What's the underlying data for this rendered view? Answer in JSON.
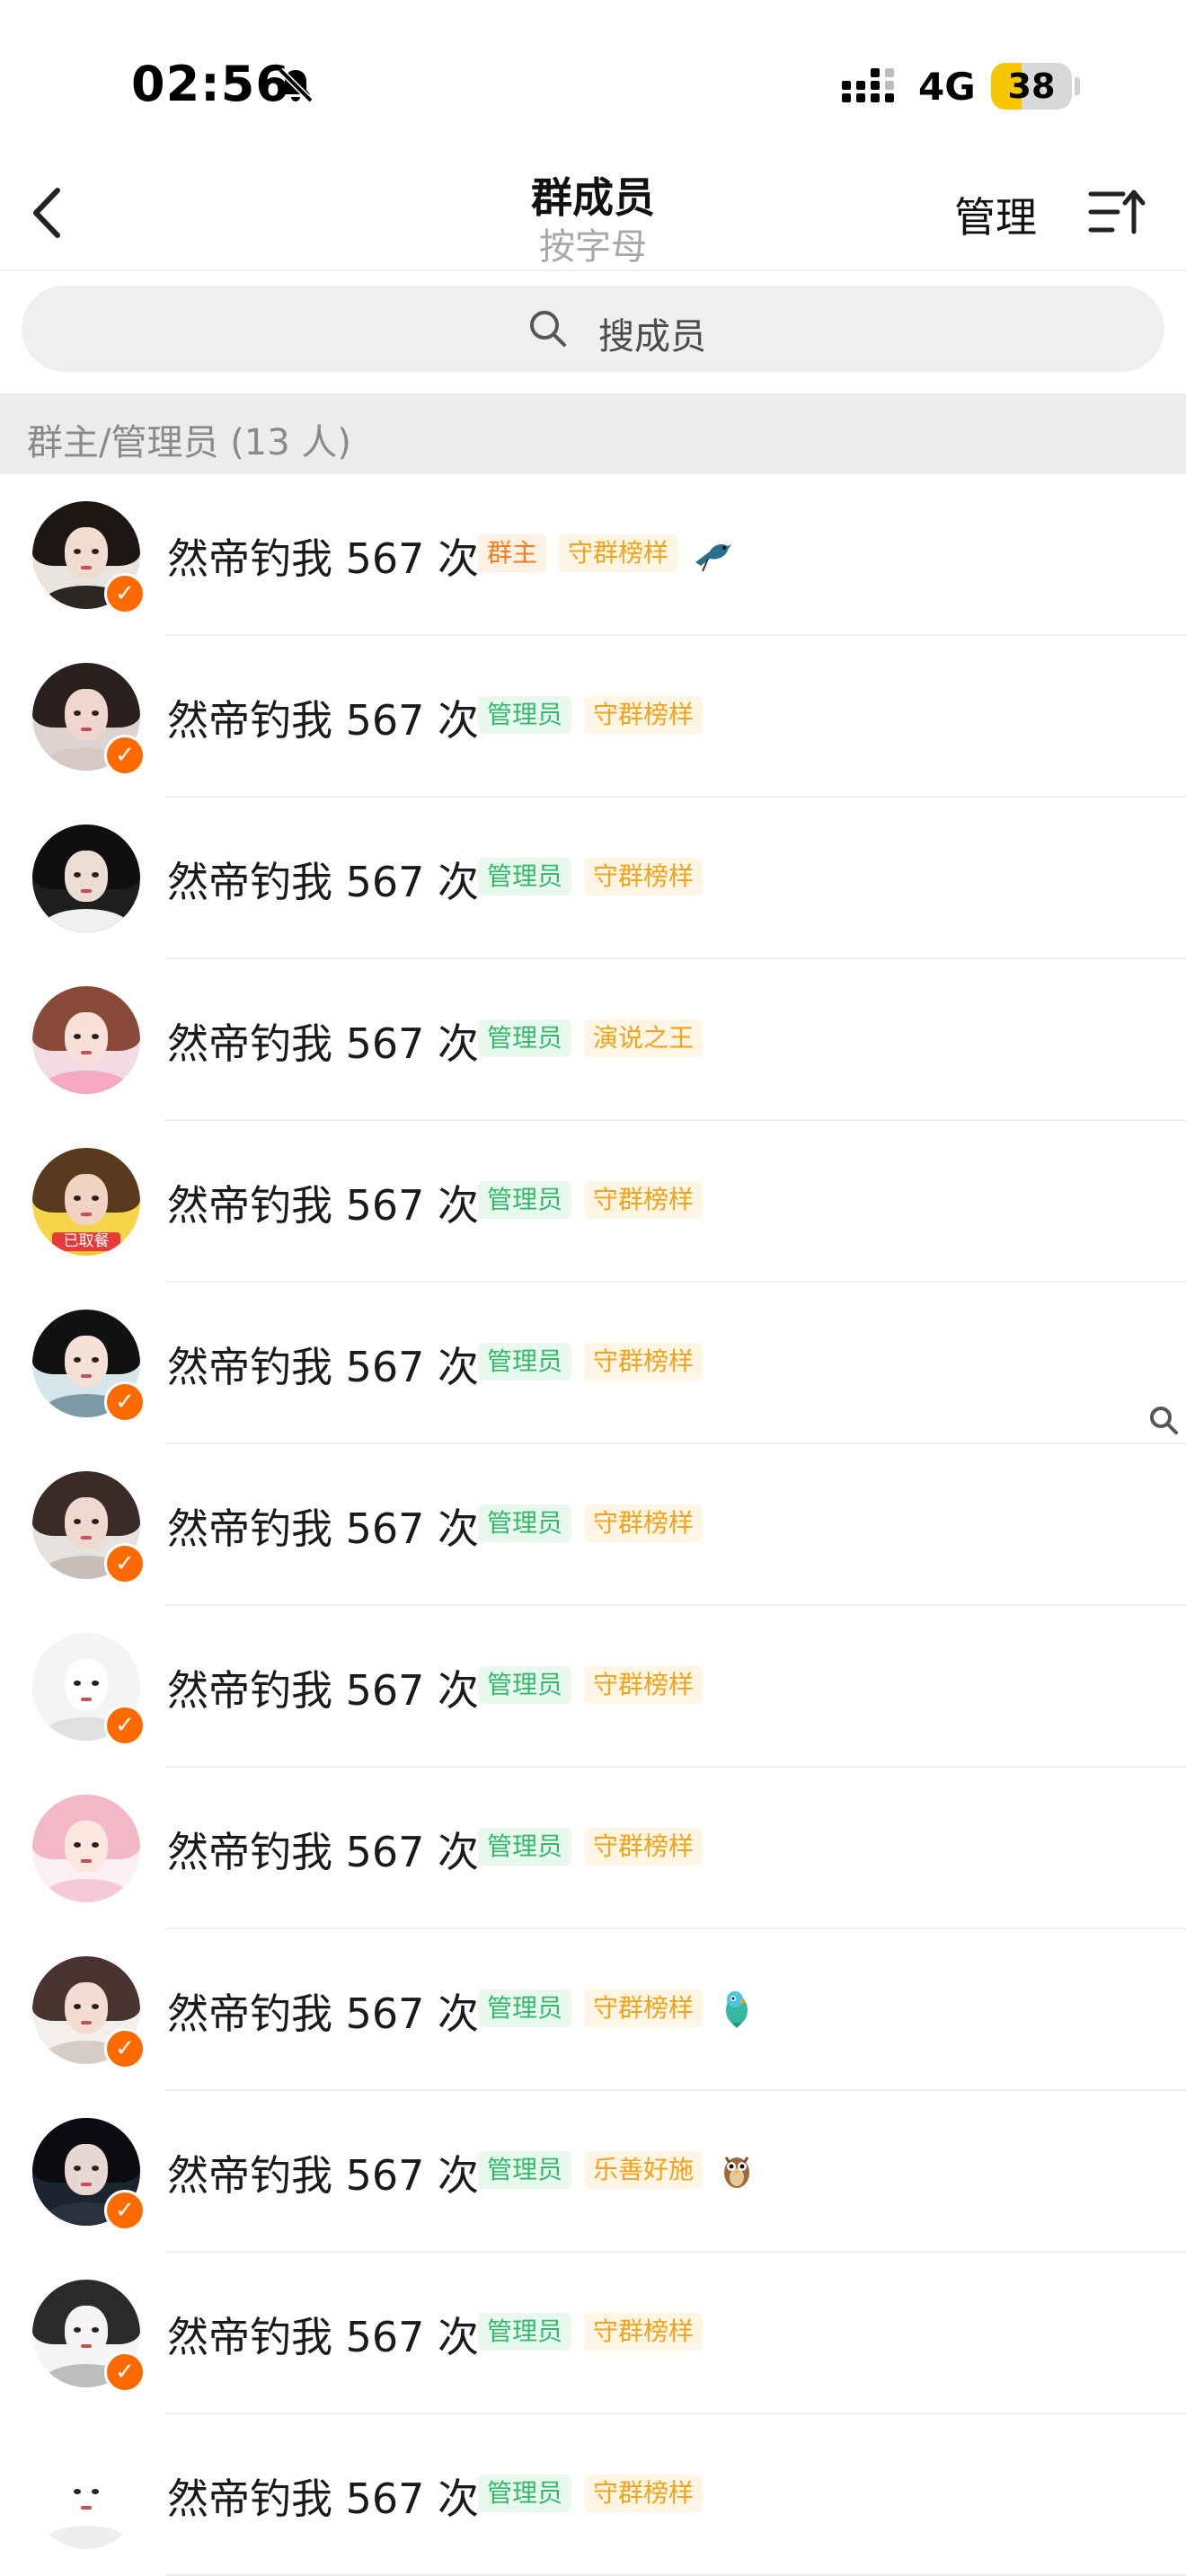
{
  "status_bar": {
    "time": "02:56",
    "network": "4G",
    "battery_level": "38",
    "battery_fraction": 0.38
  },
  "header": {
    "title": "群成员",
    "subtitle": "按字母",
    "manage_label": "管理"
  },
  "search": {
    "placeholder": "搜成员"
  },
  "section": {
    "title": "群主/管理员 (13 人)"
  },
  "members": [
    {
      "name": "然帝钓我 567 次",
      "role": "群主",
      "role_type": "owner",
      "honor": "守群榜样",
      "vip": true,
      "emoji": "bird-icon"
    },
    {
      "name": "然帝钓我 567 次",
      "role": "管理员",
      "role_type": "admin",
      "honor": "守群榜样",
      "vip": true
    },
    {
      "name": "然帝钓我 567 次",
      "role": "管理员",
      "role_type": "admin",
      "honor": "守群榜样",
      "vip": false
    },
    {
      "name": "然帝钓我 567 次",
      "role": "管理员",
      "role_type": "admin",
      "honor": "演说之王",
      "vip": false
    },
    {
      "name": "然帝钓我 567 次",
      "role": "管理员",
      "role_type": "admin",
      "honor": "守群榜样",
      "vip": false,
      "avatar_tag": "已取餐"
    },
    {
      "name": "然帝钓我 567 次",
      "role": "管理员",
      "role_type": "admin",
      "honor": "守群榜样",
      "vip": true
    },
    {
      "name": "然帝钓我 567 次",
      "role": "管理员",
      "role_type": "admin",
      "honor": "守群榜样",
      "vip": true
    },
    {
      "name": "然帝钓我 567 次",
      "role": "管理员",
      "role_type": "admin",
      "honor": "守群榜样",
      "vip": true
    },
    {
      "name": "然帝钓我 567 次",
      "role": "管理员",
      "role_type": "admin",
      "honor": "守群榜样",
      "vip": false
    },
    {
      "name": "然帝钓我 567 次",
      "role": "管理员",
      "role_type": "admin",
      "honor": "守群榜样",
      "vip": true,
      "emoji": "parrot-icon"
    },
    {
      "name": "然帝钓我 567 次",
      "role": "管理员",
      "role_type": "admin",
      "honor": "乐善好施",
      "vip": true,
      "emoji": "owl-icon"
    },
    {
      "name": "然帝钓我 567 次",
      "role": "管理员",
      "role_type": "admin",
      "honor": "守群榜样",
      "vip": true
    },
    {
      "name": "然帝钓我 567 次",
      "role": "管理员",
      "role_type": "admin",
      "honor": "守群榜样",
      "vip": false
    }
  ],
  "colors": {
    "owner_text": "#ff7a1a",
    "admin_text": "#34b86a",
    "honor_text": "#f3a21a",
    "vip_badge": "#ff6a00",
    "battery": "#f7c600"
  }
}
